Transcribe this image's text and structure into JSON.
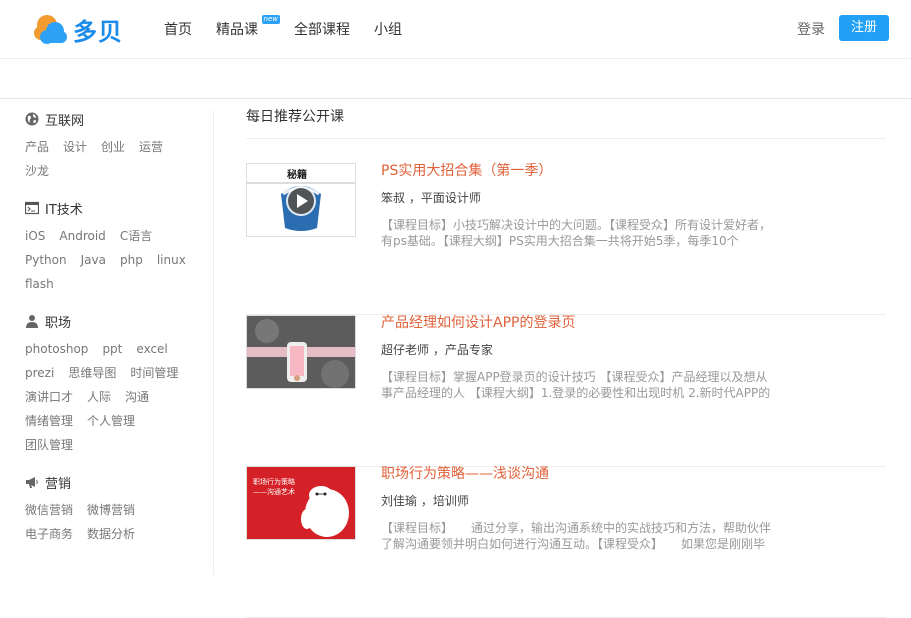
{
  "brand": {
    "name": "多贝",
    "color": "#1a8be8"
  },
  "nav": {
    "items": [
      {
        "label": "首页"
      },
      {
        "label": "精品课",
        "badge": "new"
      },
      {
        "label": "全部课程"
      },
      {
        "label": "小组"
      }
    ],
    "login_label": "登录",
    "register_label": "注册"
  },
  "sidebar": {
    "categories": [
      {
        "title": "互联网",
        "icon": "globe-icon",
        "tags": [
          "产品",
          "设计",
          "创业",
          "运营",
          "沙龙"
        ]
      },
      {
        "title": "IT技术",
        "icon": "terminal-icon",
        "tags": [
          "iOS",
          "Android",
          "C语言",
          "Python",
          "Java",
          "php",
          "linux",
          "flash"
        ]
      },
      {
        "title": "职场",
        "icon": "person-icon",
        "tags": [
          "photoshop",
          "ppt",
          "excel",
          "prezi",
          "思维导图",
          "时间管理",
          "演讲口才",
          "人际",
          "沟通",
          "情绪管理",
          "个人管理",
          "团队管理"
        ]
      },
      {
        "title": "营销",
        "icon": "megaphone-icon",
        "tags": [
          "微信营销",
          "微博营销",
          "电子商务",
          "数据分析"
        ]
      }
    ]
  },
  "main": {
    "title": "每日推荐公开课",
    "courses": [
      {
        "title": "PS实用大招合集（第一季）",
        "teacher": "笨叔 ，平面设计师",
        "desc": "【课程目标】小技巧解决设计中的大问题。【课程受众】所有设计爱好者，有ps基础。【课程大纲】PS实用大招合集一共将开始5季，每季10个",
        "thumb_text": "秘籍"
      },
      {
        "title": "产品经理如何设计APP的登录页",
        "teacher": "超仔老师 ，产品专家",
        "desc": "【课程目标】掌握APP登录页的设计技巧 【课程受众】产品经理以及想从事产品经理的人 【课程大纲】1.登录的必要性和出现时机 2.新时代APP的",
        "thumb_text": ""
      },
      {
        "title": "职场行为策略——浅谈沟通",
        "teacher": "刘佳瑜 ，培训师",
        "desc": "【课程目标】　　通过分享，输出沟通系统中的实战技巧和方法，帮助伙伴了解沟通要领并明白如何进行沟通互动。【课程受众】　　如果您是刚刚毕",
        "thumb_text": "职场行为策略 ——沟通艺术"
      }
    ]
  },
  "colors": {
    "accent": "#22a0f5",
    "course_title": "#e0613a"
  }
}
